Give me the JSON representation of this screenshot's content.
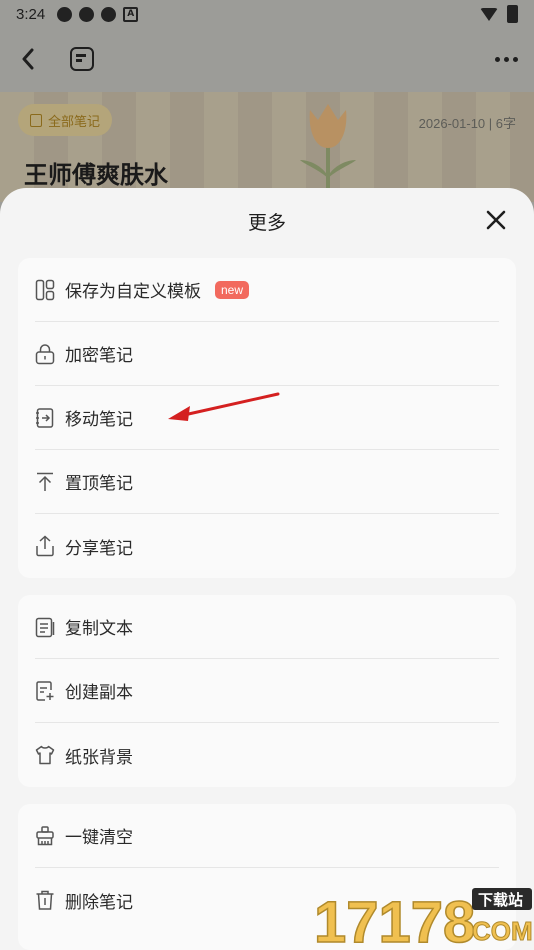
{
  "status_bar": {
    "time": "3:24"
  },
  "note": {
    "folder_label": "全部笔记",
    "date": "2026-01-10",
    "word_count": "6字",
    "title": "王师傅爽肤水"
  },
  "sheet": {
    "title": "更多",
    "groups": [
      {
        "items": [
          {
            "label": "保存为自定义模板",
            "icon": "template-icon",
            "badge": "new"
          },
          {
            "label": "加密笔记",
            "icon": "lock-icon"
          },
          {
            "label": "移动笔记",
            "icon": "move-icon"
          },
          {
            "label": "置顶笔记",
            "icon": "pin-top-icon"
          },
          {
            "label": "分享笔记",
            "icon": "share-icon"
          }
        ]
      },
      {
        "items": [
          {
            "label": "复制文本",
            "icon": "copy-icon"
          },
          {
            "label": "创建副本",
            "icon": "duplicate-icon"
          },
          {
            "label": "纸张背景",
            "icon": "shirt-icon"
          }
        ]
      },
      {
        "items": [
          {
            "label": "一键清空",
            "icon": "clear-icon"
          },
          {
            "label": "删除笔记",
            "icon": "trash-icon"
          }
        ]
      }
    ]
  },
  "watermark": {
    "text": "17178",
    "domain": "COM",
    "tag": "下载站"
  },
  "colors": {
    "badge": "#f26a5e",
    "arrow": "#d42020",
    "sheet_bg": "#f4f4f4"
  }
}
